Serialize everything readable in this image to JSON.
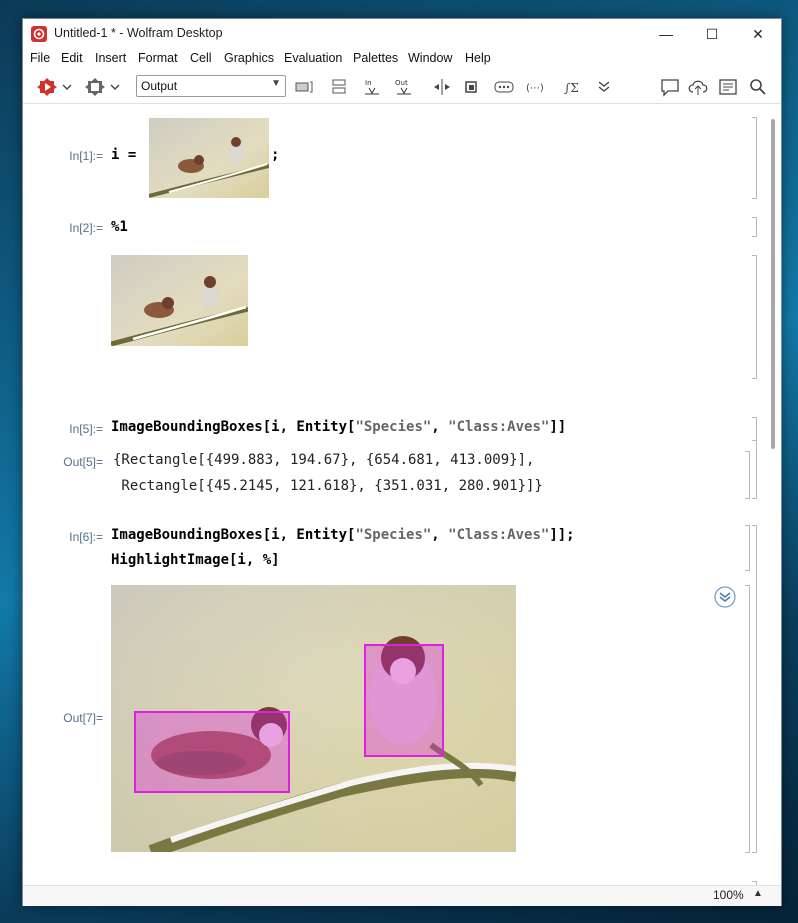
{
  "window": {
    "title": "Untitled-1 * - Wolfram Desktop",
    "controls": {
      "minimize": "—",
      "maximize": "☐",
      "close": "✕"
    }
  },
  "menu": [
    "File",
    "Edit",
    "Insert",
    "Format",
    "Cell",
    "Graphics",
    "Evaluation",
    "Palettes",
    "Window",
    "Help"
  ],
  "toolbar": {
    "style_value": "Output"
  },
  "cells": {
    "in1": {
      "label": "In[1]:=",
      "code_before": "i = ",
      "code_after": ";"
    },
    "in2": {
      "label": "In[2]:=",
      "code": "%1"
    },
    "in5": {
      "label": "In[5]:=",
      "code_pre": "ImageBoundingBoxes[i, Entity[",
      "str1": "\"Species\"",
      "comma": ", ",
      "str2": "\"Class:Aves\"",
      "code_post": "]]"
    },
    "out5": {
      "label": "Out[5]=",
      "line1": "{Rectangle[{499.883, 194.67}, {654.681, 413.009}],",
      "line2": " Rectangle[{45.2145, 121.618}, {351.031, 280.901}]}"
    },
    "in6": {
      "label": "In[6]:=",
      "code_pre": "ImageBoundingBoxes[i, Entity[",
      "str1": "\"Species\"",
      "comma": ", ",
      "str2": "\"Class:Aves\"",
      "code_post": "]];",
      "line2": "HighlightImage[i, %]"
    },
    "out7": {
      "label": "Out[7]="
    }
  },
  "status": {
    "zoom": "100%"
  },
  "colors": {
    "highlight": "#e020e0",
    "label": "#55708a",
    "string": "#666666"
  }
}
